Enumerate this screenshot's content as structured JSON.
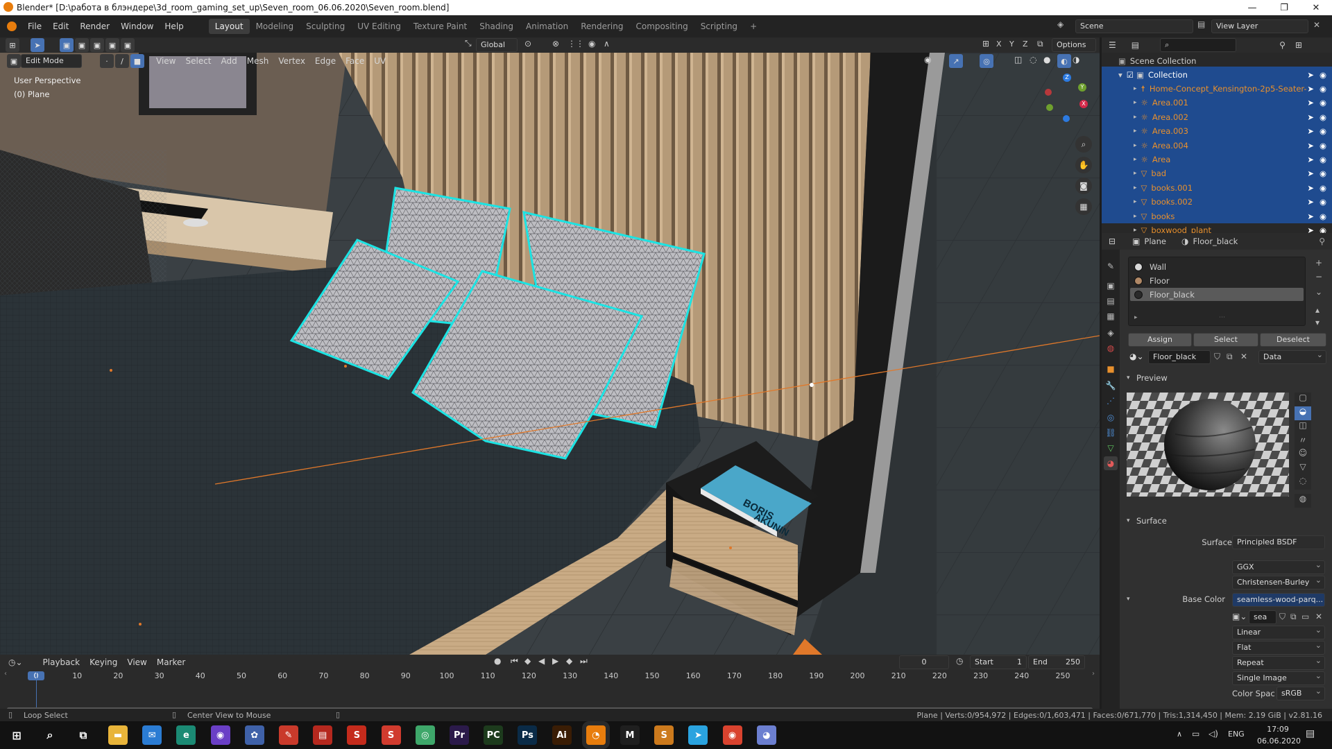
{
  "window": {
    "title": "Blender* [D:\\работа в блэндере\\3d_room_gaming_set_up\\Seven_room_06.06.2020\\Seven_room.blend]",
    "minimize": "—",
    "maximize": "❐",
    "close": "✕"
  },
  "menu": [
    "File",
    "Edit",
    "Render",
    "Window",
    "Help"
  ],
  "workspaces": [
    "Layout",
    "Modeling",
    "Sculpting",
    "UV Editing",
    "Texture Paint",
    "Shading",
    "Animation",
    "Rendering",
    "Compositing",
    "Scripting"
  ],
  "workspace_add": "+",
  "scene": {
    "label": "Scene",
    "view_layer": "View Layer"
  },
  "viewport_header": {
    "mode": "Edit Mode",
    "menus": [
      "View",
      "Select",
      "Add",
      "Mesh",
      "Vertex",
      "Edge",
      "Face",
      "UV"
    ],
    "transform_orientation": "Global",
    "axes": [
      "X",
      "Y",
      "Z"
    ],
    "options": "Options"
  },
  "viewport": {
    "perspective": "User Perspective",
    "object": "(0) Plane",
    "book_text": "BORIS",
    "book_text2": "AKUNIN"
  },
  "outliner": {
    "root": "Scene Collection",
    "collection": "Collection",
    "items": [
      {
        "name": "Home-Concept_Kensington-2p5-Seater-",
        "icon": "armature-icon"
      },
      {
        "name": "Area.001",
        "icon": "light-icon"
      },
      {
        "name": "Area.002",
        "icon": "light-icon"
      },
      {
        "name": "Area.003",
        "icon": "light-icon"
      },
      {
        "name": "Area.004",
        "icon": "light-icon"
      },
      {
        "name": "Area",
        "icon": "light-icon"
      },
      {
        "name": "bad",
        "icon": "mesh-icon"
      },
      {
        "name": "books.001",
        "icon": "mesh-icon"
      },
      {
        "name": "books.002",
        "icon": "mesh-icon"
      },
      {
        "name": "books",
        "icon": "mesh-icon"
      },
      {
        "name": "boxwood_plant",
        "icon": "mesh-icon"
      }
    ]
  },
  "properties": {
    "object": "Plane",
    "material": "Floor_black",
    "slots": [
      "Wall",
      "Floor",
      "Floor_black"
    ],
    "slot_buttons": [
      "Assign",
      "Select",
      "Deselect"
    ],
    "material_field": "Floor_black",
    "link": "Data",
    "preview_label": "Preview",
    "surface_label": "Surface",
    "surface": {
      "label": "Surface",
      "value": "Principled BSDF"
    },
    "distribution": "GGX",
    "subsurface": "Christensen-Burley",
    "base_color": {
      "label": "Base Color",
      "value": "seamless-wood-parq..."
    },
    "image_name": "sea",
    "interpolation": "Linear",
    "projection": "Flat",
    "extension": "Repeat",
    "source": "Single Image",
    "color_space": {
      "label": "Color Spac",
      "value": "sRGB"
    }
  },
  "timeline": {
    "menus": [
      "Playback",
      "Keying",
      "View",
      "Marker"
    ],
    "current_frame": "0",
    "start_label": "Start",
    "start": "1",
    "end_label": "End",
    "end": "250",
    "ticks": [
      "0",
      "10",
      "20",
      "30",
      "40",
      "50",
      "60",
      "70",
      "80",
      "90",
      "100",
      "110",
      "120",
      "130",
      "140",
      "150",
      "160",
      "170",
      "180",
      "190",
      "200",
      "210",
      "220",
      "230",
      "240",
      "250"
    ]
  },
  "status": {
    "left": "Loop Select",
    "middle": "Center View to Mouse",
    "right": "Plane | Verts:0/954,972 | Edges:0/1,603,471 | Faces:0/671,770 | Tris:1,314,450 | Mem: 2.19 GiB | v2.81.16"
  },
  "taskbar": {
    "apps": [
      {
        "name": "file-explorer-icon",
        "glyph": "▬",
        "color": "#e8b43a"
      },
      {
        "name": "mail-icon",
        "glyph": "✉",
        "color": "#2b7cd3"
      },
      {
        "name": "edge-browser-icon",
        "glyph": "e",
        "color": "#1b8a74"
      },
      {
        "name": "podcast-app-icon",
        "glyph": "◉",
        "color": "#6a3fc6"
      },
      {
        "name": "unity-hub-icon",
        "glyph": "✿",
        "color": "#3f61a8"
      },
      {
        "name": "pdf-reader-icon",
        "glyph": "✎",
        "color": "#c93a2b"
      },
      {
        "name": "archive-app-icon",
        "glyph": "▤",
        "color": "#b5281e"
      },
      {
        "name": "sketchup-icon",
        "glyph": "S",
        "color": "#c42b1c"
      },
      {
        "name": "substance-icon",
        "glyph": "S",
        "color": "#d03b2e"
      },
      {
        "name": "sound-app-icon",
        "glyph": "◎",
        "color": "#3ea76a"
      },
      {
        "name": "premiere-icon",
        "glyph": "Pr",
        "color": "#2b1a4a"
      },
      {
        "name": "pycharm-icon",
        "glyph": "PC",
        "color": "#1d3b1d"
      },
      {
        "name": "photoshop-icon",
        "glyph": "Ps",
        "color": "#0a2b47"
      },
      {
        "name": "illustrator-icon",
        "glyph": "Ai",
        "color": "#3a1d05"
      },
      {
        "name": "blender-icon",
        "glyph": "◔",
        "color": "#e87d0d"
      },
      {
        "name": "m-app-icon",
        "glyph": "M",
        "color": "#1f1f1f"
      },
      {
        "name": "sublime-icon",
        "glyph": "S",
        "color": "#cc7a1d"
      },
      {
        "name": "telegram-icon",
        "glyph": "➤",
        "color": "#2aa3df"
      },
      {
        "name": "chrome-icon",
        "glyph": "◉",
        "color": "#d9432f"
      },
      {
        "name": "discord-icon",
        "glyph": "◕",
        "color": "#6c7fd0"
      }
    ],
    "lang": "ENG",
    "time": "17:09",
    "date": "06.06.2020"
  }
}
